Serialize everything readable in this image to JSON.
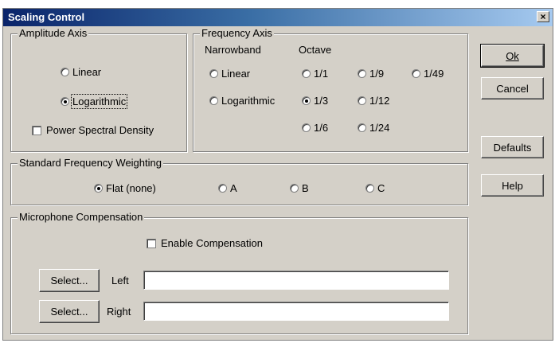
{
  "window": {
    "title": "Scaling Control",
    "close": "×"
  },
  "amplitude": {
    "label": "Amplitude Axis",
    "linear": "Linear",
    "logarithmic": "Logarithmic",
    "psd": "Power Spectral Density"
  },
  "frequency": {
    "label": "Frequency Axis",
    "narrowband_label": "Narrowband",
    "octave_label": "Octave",
    "nb_linear": "Linear",
    "nb_log": "Logarithmic",
    "oct": [
      "1/1",
      "1/9",
      "1/49",
      "1/3",
      "1/12",
      "1/6",
      "1/24"
    ]
  },
  "weighting": {
    "label": "Standard Frequency Weighting",
    "options": [
      "Flat (none)",
      "A",
      "B",
      "C"
    ]
  },
  "mic": {
    "label": "Microphone Compensation",
    "enable": "Enable Compensation",
    "select": "Select...",
    "left": "Left",
    "right": "Right",
    "left_value": "",
    "right_value": ""
  },
  "buttons": {
    "ok": "Ok",
    "cancel": "Cancel",
    "defaults": "Defaults",
    "help": "Help"
  }
}
